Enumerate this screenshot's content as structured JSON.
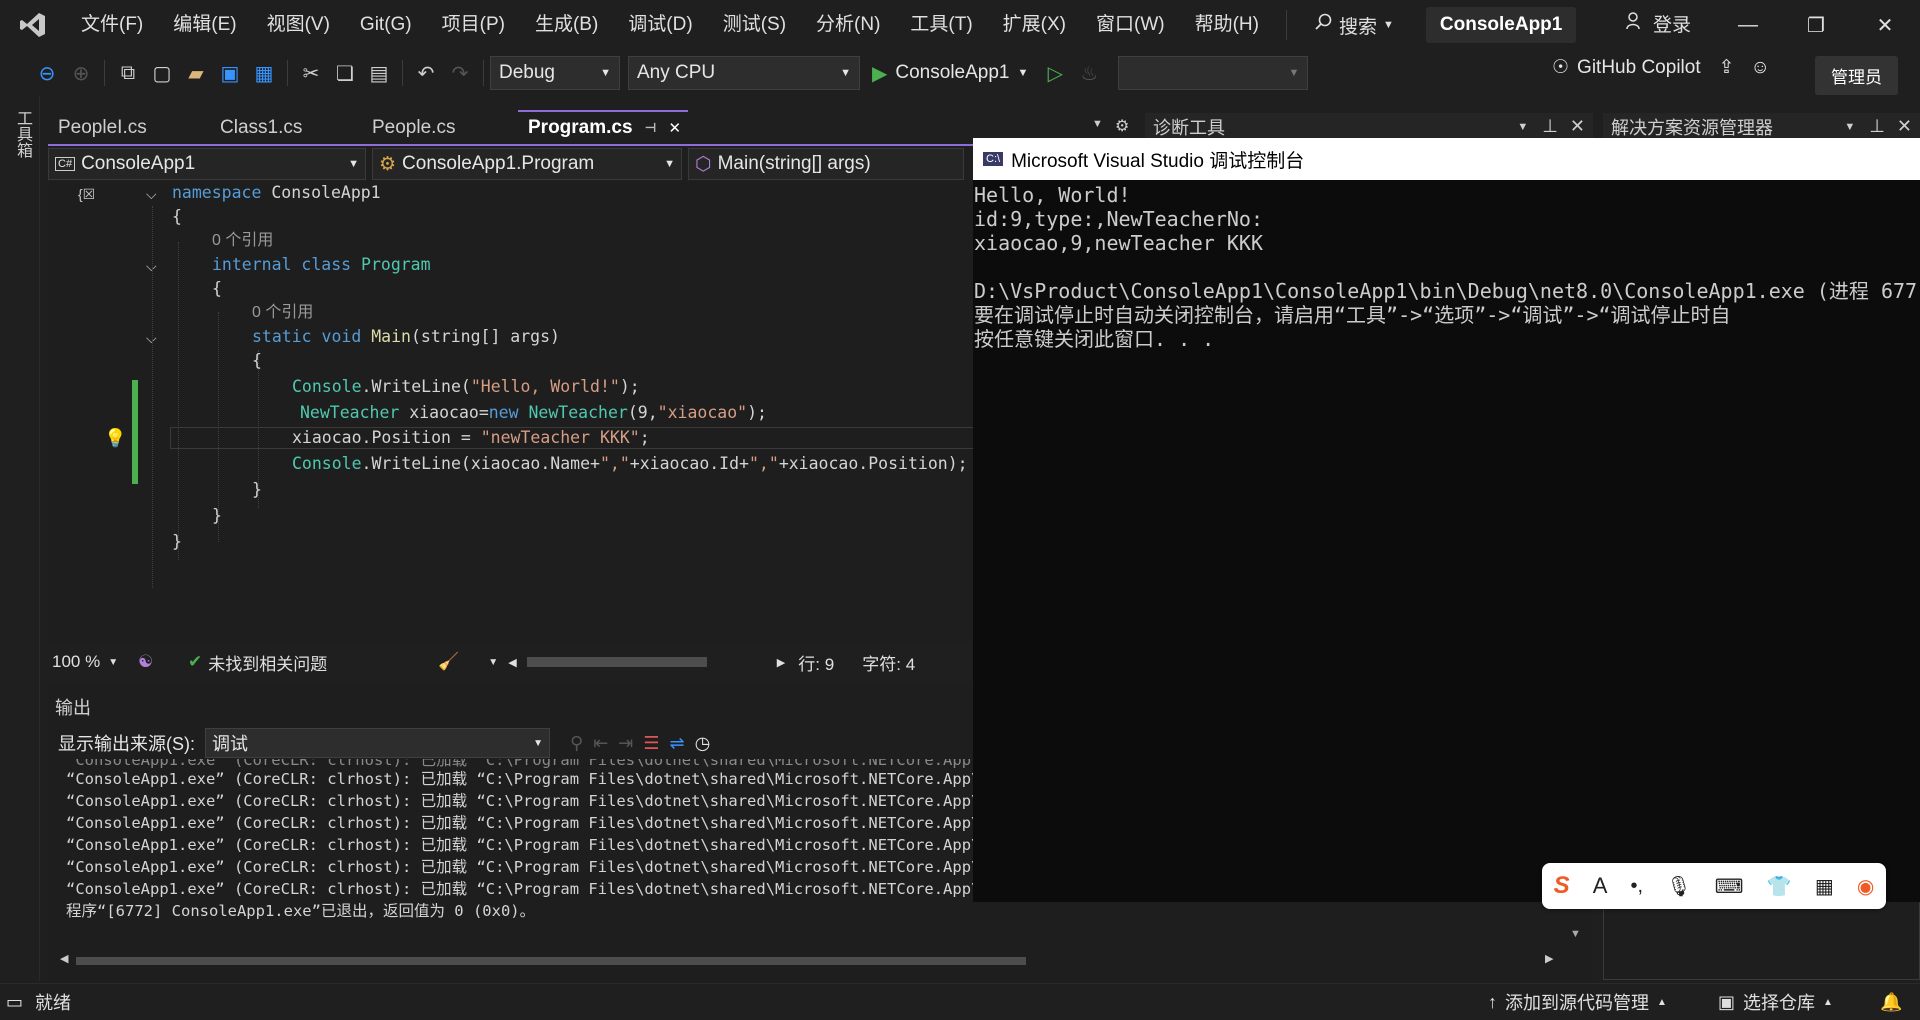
{
  "titlebar": {
    "menu": [
      "文件(F)",
      "编辑(E)",
      "视图(V)",
      "Git(G)",
      "项目(P)",
      "生成(B)",
      "调试(D)",
      "测试(S)",
      "分析(N)",
      "工具(T)",
      "扩展(X)",
      "窗口(W)",
      "帮助(H)"
    ],
    "search_label": "搜索",
    "project_title": "ConsoleApp1",
    "login_label": "登录"
  },
  "toolbar": {
    "config": "Debug",
    "platform": "Any CPU",
    "run_target": "ConsoleApp1",
    "copilot_label": "GitHub Copilot",
    "admin_label": "管理员"
  },
  "leftstrip": {
    "toolbox_label": "工具箱"
  },
  "tabs": [
    {
      "label": "PeopleI.cs",
      "active": false
    },
    {
      "label": "Class1.cs",
      "active": false
    },
    {
      "label": "People.cs",
      "active": false
    },
    {
      "label": "Program.cs",
      "active": true
    }
  ],
  "navbar": {
    "project": "ConsoleApp1",
    "type": "ConsoleApp1.Program",
    "member": "Main(string[] args)"
  },
  "code": {
    "line1_kw": "namespace",
    "line1_name": "ConsoleApp1",
    "ref0": "0 个引用",
    "line2_kw": "internal class",
    "line2_name": "Program",
    "ref1": "0 个引用",
    "line3_kw": "static void",
    "line3_fn": "Main",
    "line3_args": "(string[] args)",
    "l_console1": "Console",
    "l_writeline1": ".WriteLine(",
    "l_str1": "\"Hello, World!\"",
    "l_end1": ");",
    "l_nt": "NewTeacher",
    "l_var": " xiaocao=",
    "l_new": "new",
    "l_nt2": "NewTeacher",
    "l_args": "(9,",
    "l_str2": "\"xiaocao\"",
    "l_end2": ");",
    "l_pos": "xiaocao.Position = ",
    "l_str3": "\"newTeacher KKK\"",
    "l_end3": ";",
    "l_console2": "Console",
    "l_writeline2": ".WriteLine(xiaocao.Name+",
    "l_str4": "\",\"",
    "l_mid": "+xiaocao.Id+",
    "l_str5": "\",\"",
    "l_tail": "+xiaocao.Position);",
    "brace_open": "{",
    "brace_close": "}"
  },
  "editor_status": {
    "zoom": "100 %",
    "issues": "未找到相关问题",
    "line": "行: 9",
    "char": "字符: 4"
  },
  "output": {
    "title": "输出",
    "source_label": "显示输出来源(S):",
    "source_value": "调试",
    "lines": [
      "“ConsoleApp1.exe” (CoreCLR: clrhost): 已加载 “C:\\Program Files\\dotnet\\shared\\Microsoft.NETCore.App\\8",
      "“ConsoleApp1.exe” (CoreCLR: clrhost): 已加载 “C:\\Program Files\\dotnet\\shared\\Microsoft.NETCore.App\\8",
      "“ConsoleApp1.exe” (CoreCLR: clrhost): 已加载 “C:\\Program Files\\dotnet\\shared\\Microsoft.NETCore.App\\8",
      "“ConsoleApp1.exe” (CoreCLR: clrhost): 已加载 “C:\\Program Files\\dotnet\\shared\\Microsoft.NETCore.App\\8",
      "“ConsoleApp1.exe” (CoreCLR: clrhost): 已加载 “C:\\Program Files\\dotnet\\shared\\Microsoft.NETCore.App\\8",
      "“ConsoleApp1.exe” (CoreCLR: clrhost): 已加载 “C:\\Program Files\\dotnet\\shared\\Microsoft.NETCore.App\\8"
    ],
    "exit_line": "程序“[6772] ConsoleApp1.exe”已退出，返回值为 0 (0x0)。"
  },
  "panels": {
    "diag": "诊断工具",
    "solution": "解决方案资源管理器"
  },
  "console": {
    "title": "Microsoft Visual Studio 调试控制台",
    "lines": [
      "Hello, World!",
      "id:9,type:,NewTeacherNo:",
      "xiaocao,9,newTeacher KKK",
      "",
      "D:\\VsProduct\\ConsoleApp1\\ConsoleApp1\\bin\\Debug\\net8.0\\ConsoleApp1.exe (进程 677",
      "要在调试停止时自动关闭控制台，请启用“工具”->“选项”->“调试”->“调试停止时自",
      "按任意键关闭此窗口. . ."
    ]
  },
  "statusbar": {
    "ready": "就绪",
    "add_source": "添加到源代码管理",
    "select_repo": "选择仓库"
  },
  "colors": {
    "accent": "#8e6dd8",
    "change_bar": "#4caf50"
  }
}
